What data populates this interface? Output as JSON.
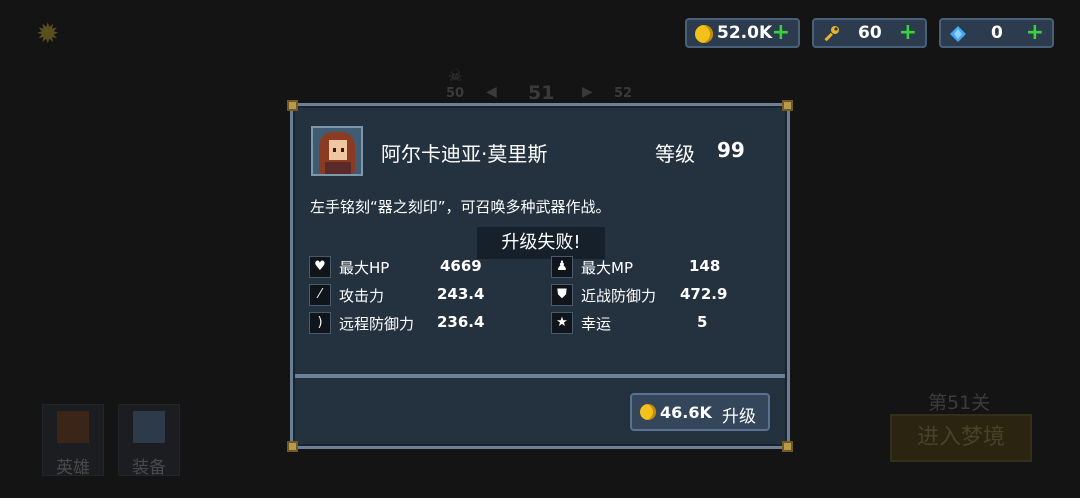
{
  "background": {
    "stage_nav": {
      "prev": "50",
      "current": "51",
      "next": "52"
    },
    "bottom_buttons": [
      {
        "label": "英雄"
      },
      {
        "label": "装备"
      }
    ],
    "level_label": "第51关",
    "enter_button": "进入梦境"
  },
  "currency": {
    "gold": {
      "value": "52.0K",
      "icon": "gold-coin-icon"
    },
    "keys": {
      "value": "60",
      "icon": "wrench-icon"
    },
    "gems": {
      "value": "0",
      "icon": "diamond-icon"
    }
  },
  "dialog": {
    "hero_name": "阿尔卡迪亚·莫里斯",
    "level_label": "等级",
    "level_value": "99",
    "description": "左手铭刻“器之刻印”，可召唤多种武器作战。",
    "toast": "升级失败!",
    "stats": [
      {
        "icon": "heart-icon",
        "label": "最大HP",
        "value": "4669"
      },
      {
        "icon": "potion-icon",
        "label": "最大MP",
        "value": "148"
      },
      {
        "icon": "sword-icon",
        "label": "攻击力",
        "value": "243.4"
      },
      {
        "icon": "shield-icon",
        "label": "近战防御力",
        "value": "472.9"
      },
      {
        "icon": "bow-icon",
        "label": "远程防御力",
        "value": "236.4"
      },
      {
        "icon": "star-icon",
        "label": "幸运",
        "value": "5"
      }
    ],
    "upgrade": {
      "price": "46.6K",
      "label": "升级"
    }
  }
}
